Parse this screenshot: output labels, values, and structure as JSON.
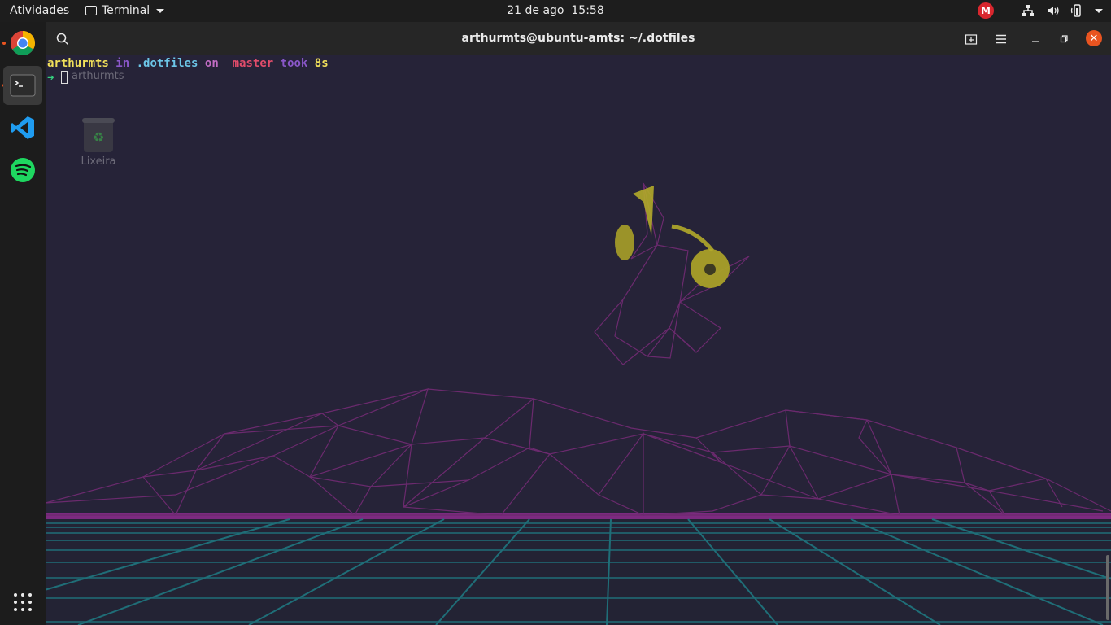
{
  "topbar": {
    "activities": "Atividades",
    "app_name": "Terminal",
    "date": "21 de ago",
    "time": "15:58",
    "mega_label": "M"
  },
  "dock": {
    "items": [
      {
        "name": "chrome-icon"
      },
      {
        "name": "terminal-icon"
      },
      {
        "name": "vscode-icon"
      },
      {
        "name": "spotify-icon"
      }
    ],
    "show_apps_icon": "apps-grid-icon"
  },
  "window": {
    "title": "arthurmts@ubuntu-amts: ~/.dotfiles",
    "close_glyph": "✕"
  },
  "terminal": {
    "user": "arthurmts",
    "in": "in",
    "dir": ".dotfiles",
    "on": "on",
    "branch_icon": "",
    "branch": "master",
    "took": "took",
    "duration": "8s",
    "arrow": "➜"
  },
  "desktop": {
    "ghost_label": "arthurmts",
    "trash_label": "Lixeira"
  },
  "colors": {
    "accent": "#e95420",
    "grid_teal": "#1f7c84",
    "mountain_purple": "#6b2a6e",
    "horizon_magenta": "#8a2c8c",
    "headphones_yellow": "#c9c12a"
  }
}
